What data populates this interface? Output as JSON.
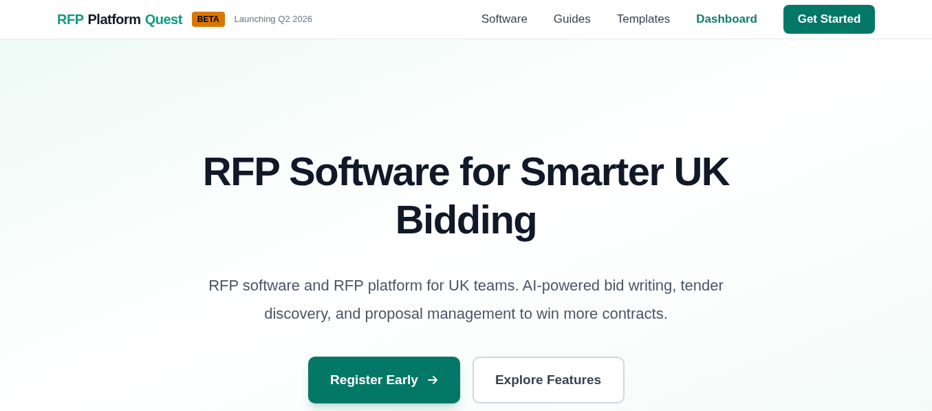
{
  "header": {
    "logo": [
      {
        "text": "RFP",
        "accent": true
      },
      {
        "text": "Platform",
        "accent": false
      },
      {
        "text": "Quest",
        "accent": true
      }
    ],
    "badge": "BETA",
    "tagline": "Launching Q2 2026",
    "nav": [
      {
        "label": "Software",
        "selected": false
      },
      {
        "label": "Guides",
        "selected": false
      },
      {
        "label": "Templates",
        "selected": false
      },
      {
        "label": "Dashboard",
        "selected": true
      }
    ],
    "cta": "Get Started"
  },
  "hero": {
    "title": "RFP Software for Smarter UK Bidding",
    "subtitle": "RFP software and RFP platform for UK teams. AI-powered bid writing, tender discovery, and proposal management to win more contracts.",
    "buttons": [
      {
        "label": "Register Early",
        "kind": "primary"
      },
      {
        "label": "Explore Features",
        "kind": "secondary"
      }
    ]
  }
}
